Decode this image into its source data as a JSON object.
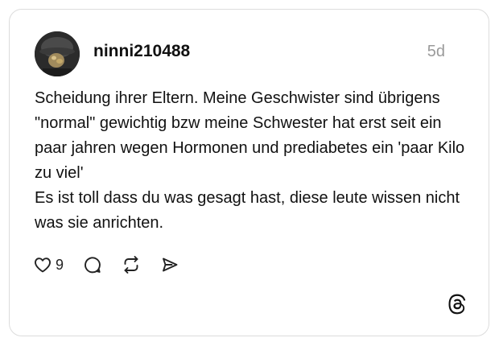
{
  "post": {
    "username": "ninni210488",
    "timestamp": "5d",
    "text": "Scheidung ihrer Eltern. Meine Geschwister sind übrigens \"normal\" gewichtig bzw meine Schwester hat erst seit ein paar jahren wegen Hormonen und prediabetes ein 'paar Kilo zu viel'\nEs ist toll dass du was gesagt hast, diese leute wissen nicht was sie anrichten.",
    "like_count": "9"
  },
  "icons": {
    "like": "heart-icon",
    "reply": "comment-icon",
    "repost": "repost-icon",
    "share": "send-icon",
    "brand": "threads-logo-icon"
  },
  "colors": {
    "text": "#111111",
    "muted": "#9a9a9a",
    "border": "#dcdcdc"
  }
}
